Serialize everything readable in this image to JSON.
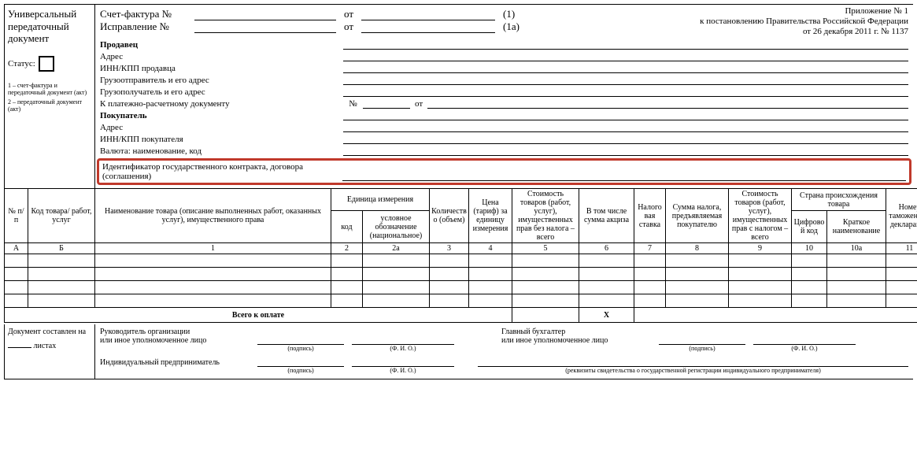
{
  "leftPanel": {
    "title_l1": "Универсальный",
    "title_l2": "передаточный",
    "title_l3": "документ",
    "statusLabel": "Статус:",
    "note1": "1 – счет-фактура и передаточный документ (акт)",
    "note2": "2 – передаточный документ (акт)"
  },
  "header": {
    "invoiceLabel": "Счет-фактура №",
    "invoiceOt": "от",
    "invoiceParen": "(1)",
    "correctionLabel": "Исправление №",
    "correctionOt": "от",
    "correctionParen": "(1а)"
  },
  "appendix": {
    "line1": "Приложение № 1",
    "line2": "к постановлению Правительства Российской Федерации",
    "line3": "от 26 декабря 2011 г. № 1137"
  },
  "fields": {
    "seller": "Продавец",
    "address": "Адрес",
    "innSeller": "ИНН/КПП продавца",
    "shipper": "Грузоотправитель и его адрес",
    "consignee": "Грузополучатель и его адрес",
    "paymentDoc": "К платежно-расчетному документу",
    "paymentNo": "№",
    "paymentOt": "от",
    "buyer": "Покупатель",
    "addressBuyer": "Адрес",
    "innBuyer": "ИНН/КПП покупателя",
    "currency": "Валюта: наименование, код",
    "govContract": "Идентификатор государственного контракта, договора (соглашения)"
  },
  "tableHeaders": {
    "numPP": "№ п/п",
    "productCode": "Код товара/ работ, услуг",
    "productName": "Наименование товара (описание выполненных работ, оказанных услуг), имущественного права",
    "unitOfMeasure": "Единица измерения",
    "unitCode": "код",
    "unitSymbol": "условное обозначение (национальное)",
    "quantity": "Количество (объем)",
    "price": "Цена (тариф) за единицу измерения",
    "costNoTax": "Стоимость товаров (работ, услуг), имущественных прав без налога – всего",
    "exciseSum": "В том числе сумма акциза",
    "taxRate": "Налоговая ставка",
    "taxAmount": "Сумма налога, предъявляемая покупателю",
    "costWithTax": "Стоимость товаров (работ, услуг), имущественных прав с налогом – всего",
    "origin": "Страна происхождения товара",
    "digitCode": "Цифровой код",
    "shortName": "Краткое наименование",
    "customsDecl": "Номер таможенной декларации",
    "colA": "А",
    "colB": "Б",
    "col1": "1",
    "col2": "2",
    "col2a": "2а",
    "col3": "3",
    "col4": "4",
    "col5": "5",
    "col6": "6",
    "col7": "7",
    "col8": "8",
    "col9": "9",
    "col10": "10",
    "col10a": "10а",
    "col11": "11"
  },
  "totals": {
    "label": "Всего к оплате",
    "xMark": "Х"
  },
  "footer": {
    "docCompiled": "Документ составлен на",
    "sheets": "листах",
    "headOrg": "Руководитель организации",
    "orAuthorized": "или иное уполномоченное лицо",
    "chiefAcc": "Главный бухгалтер",
    "indivEntr": "Индивидуальный предприниматель",
    "signature": "(подпись)",
    "fio": "(Ф. И. О.)",
    "entrDetails": "(реквизиты свидетельства о государственной регистрации индивидуального предпринимателя)"
  }
}
